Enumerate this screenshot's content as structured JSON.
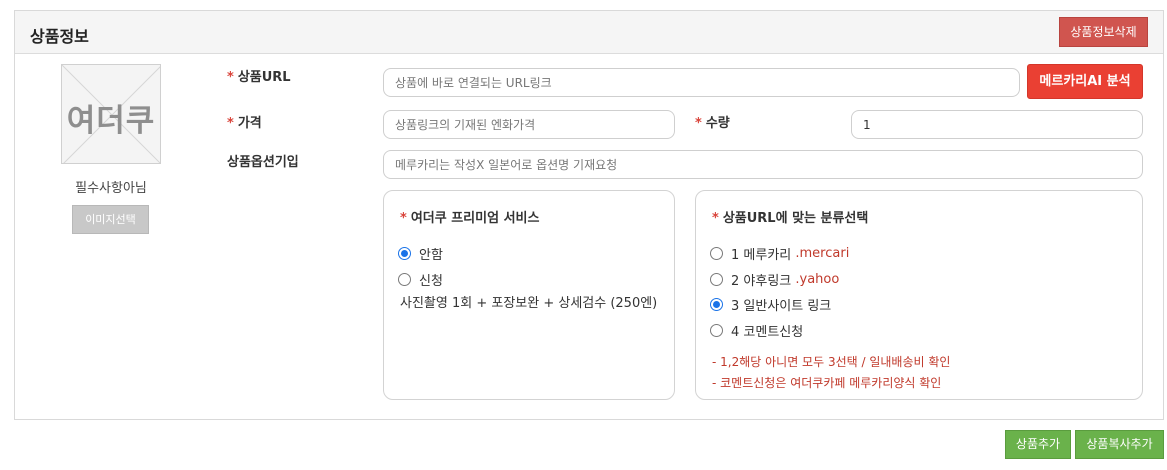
{
  "header": {
    "title": "상품정보",
    "delete_label": "상품정보삭제"
  },
  "thumbnail": {
    "logo_text": "여더쿠",
    "optional_text": "필수사항아님",
    "select_label": "이미지선택"
  },
  "fields": {
    "url": {
      "required_mark": "*",
      "label": "상품URL",
      "placeholder": "상품에 바로 연결되는 URL링크",
      "value": ""
    },
    "ai_button_label": "메르카리AI 분석",
    "price": {
      "required_mark": "*",
      "label": "가격",
      "placeholder": "상품링크의 기재된 엔화가격",
      "value": ""
    },
    "quantity": {
      "required_mark": "*",
      "label": "수량",
      "value": "1"
    },
    "option": {
      "label": "상품옵션기입",
      "placeholder": "메루카리는 작성X 일본어로 옵션명 기재요청",
      "value": ""
    }
  },
  "premium": {
    "required_mark": "*",
    "title": "여더쿠 프리미엄 서비스",
    "options": [
      {
        "label": "안함",
        "checked": true
      },
      {
        "label": "신청",
        "checked": false
      }
    ],
    "description": "사진촬영 1회 + 포장보완 + 상세검수 (250엔)"
  },
  "category": {
    "required_mark": "*",
    "title": "상품URL에 맞는 분류선택",
    "options": [
      {
        "label": "1 메루카리",
        "suffix": ".mercari",
        "checked": false
      },
      {
        "label": "2 야후링크",
        "suffix": ".yahoo",
        "checked": false
      },
      {
        "label": "3 일반사이트 링크",
        "suffix": "",
        "checked": true
      },
      {
        "label": "4 코멘트신청",
        "suffix": "",
        "checked": false
      }
    ],
    "notes": [
      "- 1,2해당 아니면 모두 3선택 / 일내배송비 확인",
      "- 코멘트신청은 여더쿠카페 메루카리양식 확인"
    ]
  },
  "footer": {
    "add_label": "상품추가",
    "copy_add_label": "상품복사추가"
  },
  "colors": {
    "delete_button": "#d0554f",
    "ai_button": "#ea4033",
    "footer_buttons": "#6ab24b",
    "required": "#d9433a",
    "radio_checked": "#1a73e8"
  }
}
